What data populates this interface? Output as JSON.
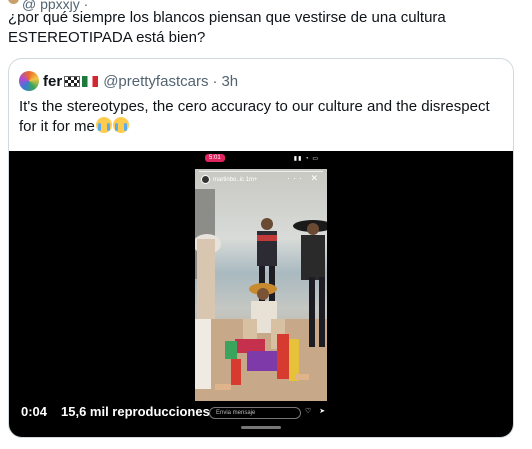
{
  "tweet": {
    "truncated_header": "@ ppxxjy ·",
    "text": "¿por qué siempre los blancos piensan que vestirse de una cultura ESTEREOTIPADA está bien?"
  },
  "quoted_tweet": {
    "name": "fer",
    "handle": "@prettyfastcars",
    "separator": "·",
    "time": "3h",
    "text": "It's the stereotypes, the cero accuracy to our culture and the disrespect for it for me",
    "emojis": [
      "crying-face",
      "crying-face"
    ]
  },
  "video": {
    "elapsed": "0:04",
    "views": "15,6 mil reproducciones",
    "story": {
      "record_badge": "5:01",
      "status_icons": "▮▮ ◔ ▭",
      "username": "martinbo..ic 1m+",
      "top_icons": "··· ✕",
      "reply_placeholder": "Envia mensaje",
      "reply_icons": "♡ ➤"
    }
  },
  "colors": {
    "text": "#0f1419",
    "secondary": "#536471",
    "border": "#cfd9de",
    "video_bg": "#000000"
  }
}
